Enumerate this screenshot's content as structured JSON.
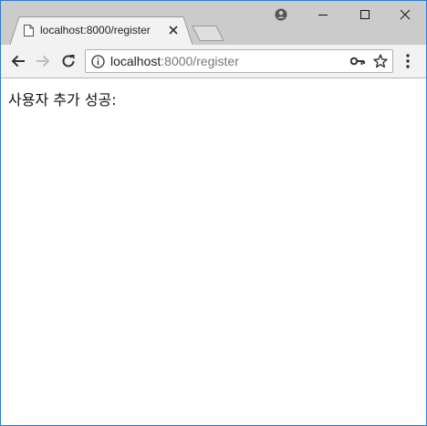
{
  "tab": {
    "title": "localhost:8000/register"
  },
  "address_bar": {
    "host": "localhost",
    "path": ":8000/register"
  },
  "page": {
    "message": "사용자 추가 성공:"
  },
  "colors": {
    "window_border": "#2b7bd8",
    "tabstrip": "#cbcbcb",
    "toolbar": "#f2f2f2"
  }
}
